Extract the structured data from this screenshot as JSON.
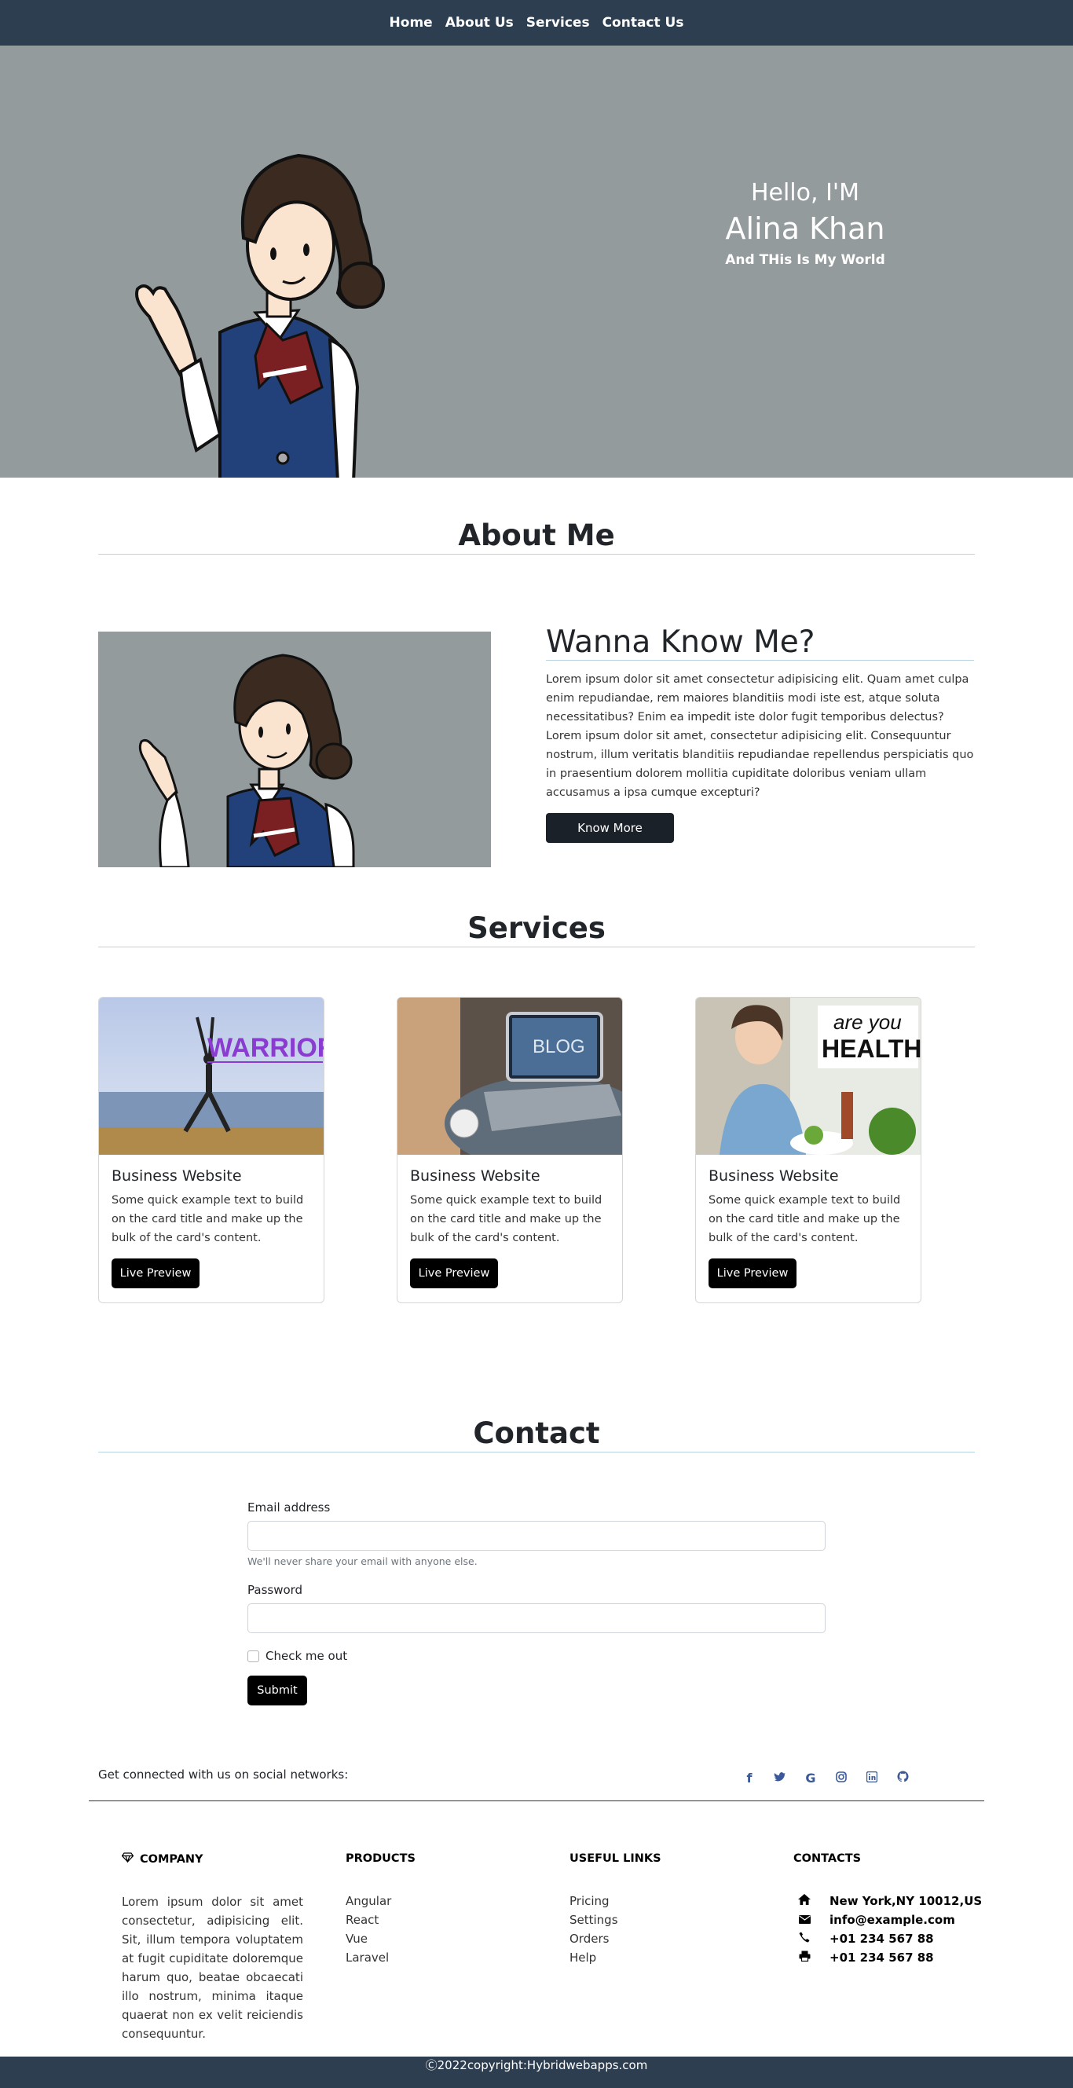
{
  "nav": {
    "items": [
      "Home",
      "About Us",
      "Services",
      "Contact Us"
    ]
  },
  "hero": {
    "greeting": "Hello, I'M",
    "name": "Alina Khan",
    "tagline": "And THis Is My World"
  },
  "about": {
    "section_title": "About Me",
    "heading": "Wanna Know Me?",
    "paragraph": "Lorem ipsum dolor sit amet consectetur adipisicing elit. Quam amet culpa enim repudiandae, rem maiores blanditiis modi iste est, atque soluta necessitatibus? Enim ea impedit iste dolor fugit temporibus delectus? Lorem ipsum dolor sit amet, consectetur adipisicing elit. Consequuntur nostrum, illum veritatis blanditiis repudiandae repellendus perspiciatis quo in praesentium dolorem mollitia cupiditate doloribus veniam ullam accusamus a ipsa cumque excepturi?",
    "button": "Know More"
  },
  "services": {
    "section_title": "Services",
    "cards": [
      {
        "image_text": "WARRIOR I",
        "title": "Business Website",
        "text": "Some quick example text to build on the card title and make up the bulk of the card's content.",
        "button": "Live Preview"
      },
      {
        "image_text": "BLOG",
        "title": "Business Website",
        "text": "Some quick example text to build on the card title and make up the bulk of the card's content.",
        "button": "Live Preview"
      },
      {
        "image_text_1": "are you",
        "image_text_2": "HEALTHY?",
        "title": "Business Website",
        "text": "Some quick example text to build on the card title and make up the bulk of the card's content.",
        "button": "Live Preview"
      }
    ]
  },
  "contact": {
    "section_title": "Contact",
    "email_label": "Email address",
    "email_help": "We'll never share your email with anyone else.",
    "password_label": "Password",
    "checkbox_label": "Check me out",
    "submit": "Submit"
  },
  "social": {
    "text": "Get connected with us on social networks:",
    "icons": [
      "facebook-icon",
      "twitter-icon",
      "google-icon",
      "instagram-icon",
      "linkedin-icon",
      "github-icon"
    ]
  },
  "footer": {
    "company": {
      "title": "COMPANY",
      "text": "Lorem ipsum dolor sit amet consectetur, adipisicing elit. Sit, illum tempora voluptatem at fugit cupiditate doloremque harum quo, beatae obcaecati illo nostrum, minima itaque quaerat non ex velit reiciendis consequuntur."
    },
    "products": {
      "title": "PRODUCTS",
      "links": [
        "Angular",
        "React",
        "Vue",
        "Laravel"
      ]
    },
    "useful_links": {
      "title": "USEFUL LINKS",
      "links": [
        "Pricing",
        "Settings",
        "Orders",
        "Help"
      ]
    },
    "contacts": {
      "title": "CONTACTS",
      "address": "New York,NY 10012,US",
      "email": "info@example.com",
      "phone": "+01 234 567 88",
      "fax": "+01 234 567 88"
    }
  },
  "copyright": "Ⓒ2022copyright:Hybridwebapps.com",
  "colors": {
    "navbar": "#2c3e50",
    "hero_bg": "#949b9d",
    "accent_line": "#b7d3e6",
    "button_dark": "#1b2129"
  }
}
